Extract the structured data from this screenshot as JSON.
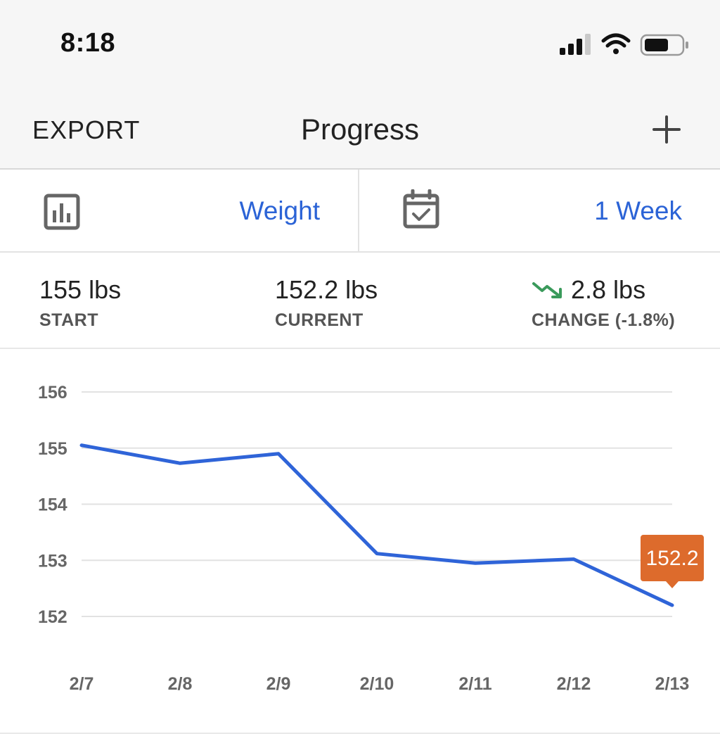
{
  "status_bar": {
    "time": "8:18",
    "icons": [
      "cellular-signal-icon",
      "wifi-icon",
      "battery-icon"
    ]
  },
  "nav": {
    "export_label": "EXPORT",
    "title": "Progress",
    "add_icon": "plus-icon"
  },
  "selectors": {
    "metric": {
      "icon": "bar-chart-icon",
      "value": "Weight"
    },
    "range": {
      "icon": "calendar-check-icon",
      "value": "1 Week"
    }
  },
  "stats": {
    "start": {
      "value": "155 lbs",
      "label": "START"
    },
    "current": {
      "value": "152.2 lbs",
      "label": "CURRENT"
    },
    "change": {
      "value": "2.8 lbs",
      "label": "CHANGE (-1.8%)",
      "trend_icon": "trending-down-icon"
    }
  },
  "colors": {
    "accent": "#2b63d6",
    "line": "#2f64d8",
    "tooltip": "#dd6b2c",
    "trend_down": "#3a9a5b"
  },
  "chart_data": {
    "type": "line",
    "x": [
      "2/7",
      "2/8",
      "2/9",
      "2/10",
      "2/11",
      "2/12",
      "2/13"
    ],
    "series": [
      {
        "values": [
          155.05,
          154.73,
          154.9,
          153.12,
          152.95,
          153.02,
          152.2
        ]
      }
    ],
    "yticks": [
      156,
      155,
      154,
      153,
      152
    ],
    "ylim": [
      152,
      156
    ],
    "grid": true,
    "highlight": {
      "index": 6,
      "label": "152.2"
    }
  }
}
